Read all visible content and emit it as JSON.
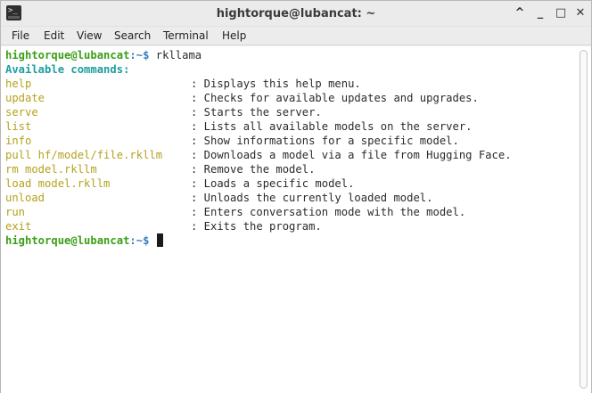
{
  "window": {
    "title": "hightorque@lubancat: ~",
    "controls": {
      "minimize_rollup": "^",
      "minimize": "_",
      "maximize": "□",
      "close": "✕"
    }
  },
  "menu": [
    "File",
    "Edit",
    "View",
    "Search",
    "Terminal",
    "Help"
  ],
  "terminal": {
    "prompt_user_host": "hightorque@lubancat",
    "prompt_path": ":~$",
    "first_command": " rkllama",
    "header": "Available commands:",
    "commands": [
      {
        "name": "help",
        "desc": ": Displays this help menu."
      },
      {
        "name": "update",
        "desc": ": Checks for available updates and upgrades."
      },
      {
        "name": "serve",
        "desc": ": Starts the server."
      },
      {
        "name": "list",
        "desc": ": Lists all available models on the server."
      },
      {
        "name": "info",
        "desc": ": Show informations for a specific model."
      },
      {
        "name": "pull hf/model/file.rkllm",
        "desc": ": Downloads a model via a file from Hugging Face."
      },
      {
        "name": "rm model.rkllm",
        "desc": ": Remove the model."
      },
      {
        "name": "load model.rkllm",
        "desc": ": Loads a specific model."
      },
      {
        "name": "unload",
        "desc": ": Unloads the currently loaded model."
      },
      {
        "name": "run",
        "desc": ": Enters conversation mode with the model."
      },
      {
        "name": "exit",
        "desc": ": Exits the program."
      }
    ]
  },
  "colors": {
    "prompt_user": "#3a9f17",
    "prompt_path": "#3a7fc1",
    "header": "#1e9ea0",
    "command_name": "#b5a21e"
  }
}
